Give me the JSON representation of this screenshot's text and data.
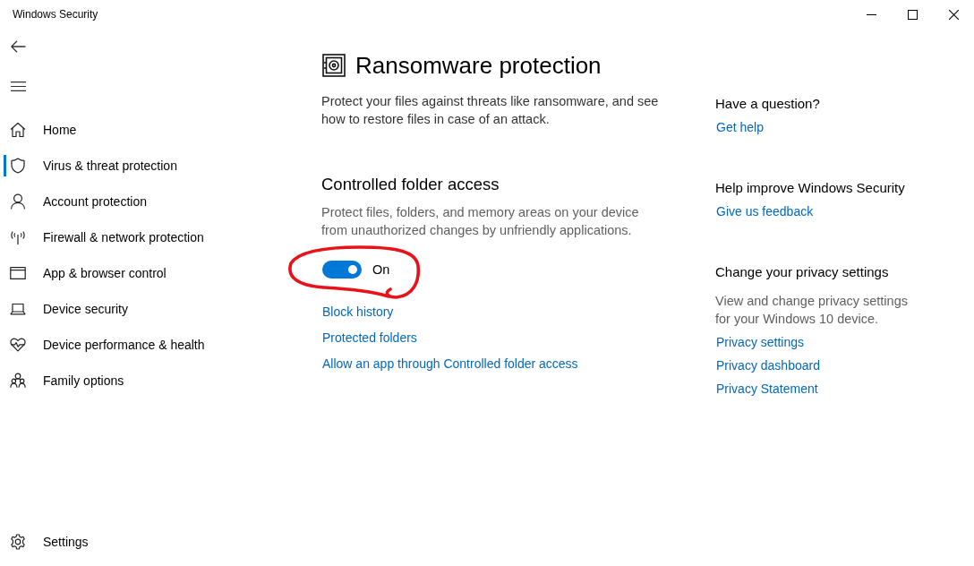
{
  "window": {
    "title": "Windows Security"
  },
  "sidebar": {
    "items": [
      {
        "label": "Home",
        "selected": false
      },
      {
        "label": "Virus & threat protection",
        "selected": true
      },
      {
        "label": "Account protection",
        "selected": false
      },
      {
        "label": "Firewall & network protection",
        "selected": false
      },
      {
        "label": "App & browser control",
        "selected": false
      },
      {
        "label": "Device security",
        "selected": false
      },
      {
        "label": "Device performance & health",
        "selected": false
      },
      {
        "label": "Family options",
        "selected": false
      }
    ],
    "settings": {
      "label": "Settings",
      "selected": false
    }
  },
  "page": {
    "title": "Ransomware protection",
    "description": "Protect your files against threats like ransomware, and see how to restore files in case of an attack.",
    "section": {
      "heading": "Controlled folder access",
      "description": "Protect files, folders, and memory areas on your device from unauthorized changes by unfriendly applications.",
      "toggle": {
        "label": "On",
        "on": true,
        "highlighted": true
      },
      "links": [
        "Block history",
        "Protected folders",
        "Allow an app through Controlled folder access"
      ]
    }
  },
  "side_panel": {
    "groups": [
      {
        "heading": "Have a question?",
        "links": [
          "Get help"
        ]
      },
      {
        "heading": "Help improve Windows Security",
        "links": [
          "Give us feedback"
        ]
      },
      {
        "heading": "Change your privacy settings",
        "description": "View and change privacy settings for your Windows 10 device.",
        "links": [
          "Privacy settings",
          "Privacy dashboard",
          "Privacy Statement"
        ]
      }
    ]
  }
}
